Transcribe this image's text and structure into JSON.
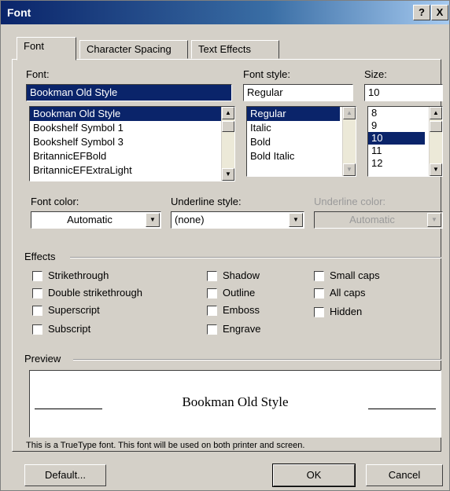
{
  "window": {
    "title": "Font",
    "help_label": "?",
    "close_label": "X"
  },
  "tabs": [
    {
      "label": "Font",
      "active": true
    },
    {
      "label": "Character Spacing",
      "active": false
    },
    {
      "label": "Text Effects",
      "active": false
    }
  ],
  "font": {
    "label": "Font:",
    "value": "Bookman Old Style",
    "items": [
      "Bookman Old Style",
      "Bookshelf Symbol 1",
      "Bookshelf Symbol 3",
      "BritannicEFBold",
      "BritannicEFExtraLight"
    ],
    "selected": "Bookman Old Style"
  },
  "font_style": {
    "label": "Font style:",
    "value": "Regular",
    "items": [
      "Regular",
      "Italic",
      "Bold",
      "Bold Italic"
    ],
    "selected": "Regular"
  },
  "size": {
    "label": "Size:",
    "value": "10",
    "items": [
      "8",
      "9",
      "10",
      "11",
      "12"
    ],
    "selected": "10"
  },
  "font_color": {
    "label": "Font color:",
    "value": "Automatic"
  },
  "underline_style": {
    "label": "Underline style:",
    "value": "(none)"
  },
  "underline_color": {
    "label": "Underline color:",
    "value": "Automatic"
  },
  "effects": {
    "label": "Effects",
    "col1": [
      "Strikethrough",
      "Double strikethrough",
      "Superscript",
      "Subscript"
    ],
    "col2": [
      "Shadow",
      "Outline",
      "Emboss",
      "Engrave"
    ],
    "col3": [
      "Small caps",
      "All caps",
      "Hidden"
    ]
  },
  "preview": {
    "label": "Preview",
    "text": "Bookman Old Style"
  },
  "note": "This is a TrueType font. This font will be used on both printer and screen.",
  "buttons": {
    "default": "Default...",
    "ok": "OK",
    "cancel": "Cancel"
  },
  "colors": {
    "titlebar_start": "#0a246a",
    "selection": "#0a246a",
    "dialog_bg": "#d4d0c8"
  }
}
